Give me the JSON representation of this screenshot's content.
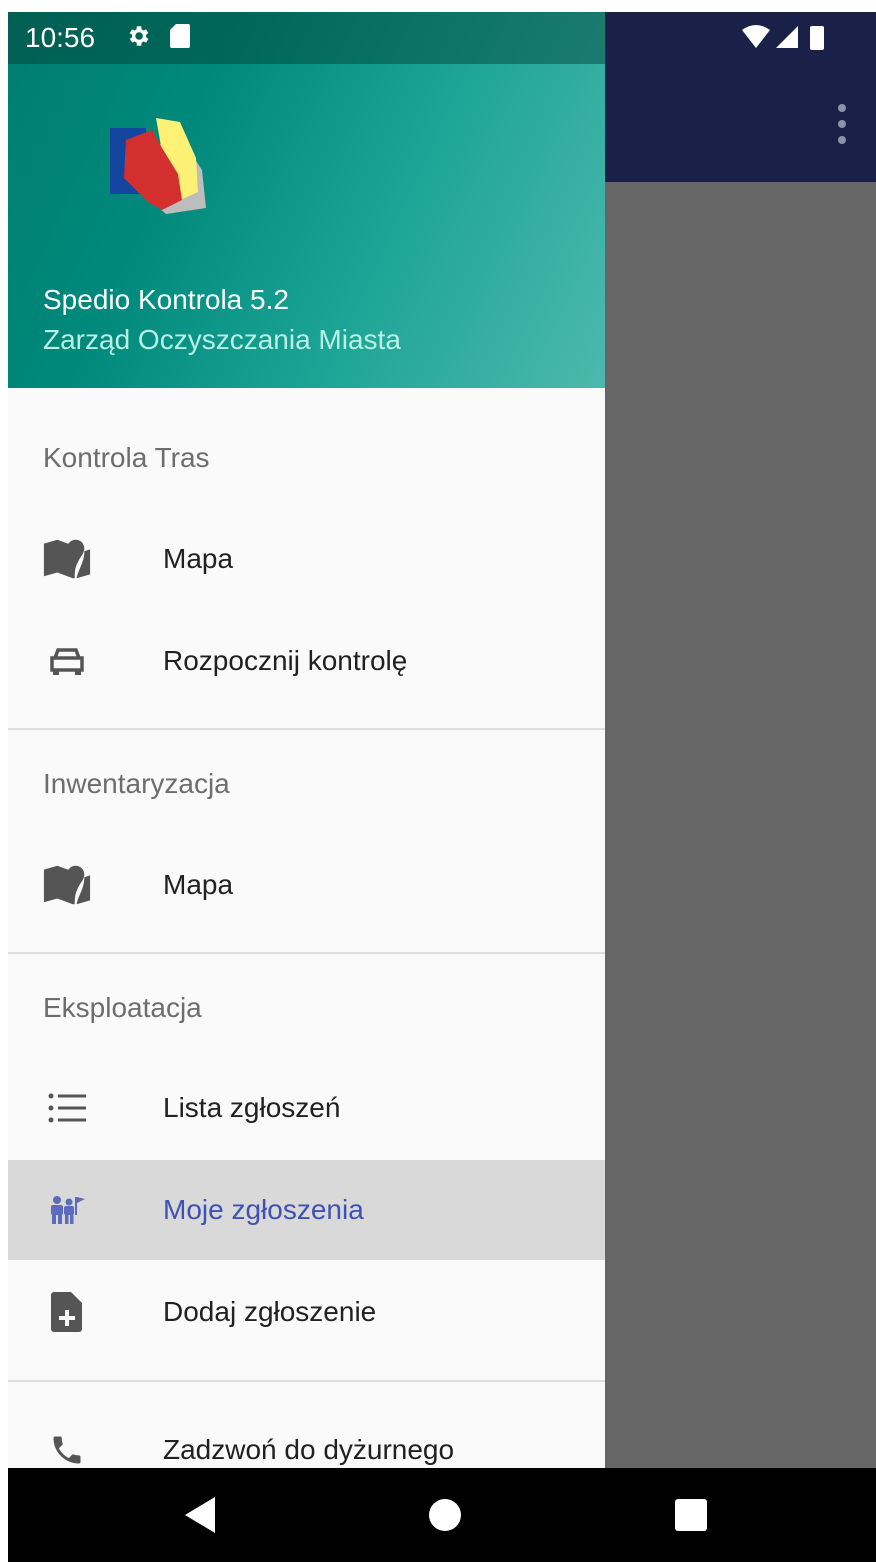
{
  "status_bar": {
    "time": "10:56"
  },
  "drawer": {
    "header": {
      "title": "Spedio Kontrola 5.2",
      "subtitle": "Zarząd Oczyszczania Miasta"
    },
    "sections": [
      {
        "header": "Kontrola Tras",
        "items": [
          {
            "label": "Mapa",
            "icon": "map-icon"
          },
          {
            "label": "Rozpocznij kontrolę",
            "icon": "car-icon"
          }
        ]
      },
      {
        "header": "Inwentaryzacja",
        "items": [
          {
            "label": "Mapa",
            "icon": "map-icon"
          }
        ]
      },
      {
        "header": "Eksploatacja",
        "items": [
          {
            "label": "Lista zgłoszeń",
            "icon": "list-icon"
          },
          {
            "label": "Moje zgłoszenia",
            "icon": "person-flag-icon",
            "selected": true
          },
          {
            "label": "Dodaj zgłoszenie",
            "icon": "add-document-icon"
          }
        ]
      },
      {
        "header": "",
        "items": [
          {
            "label": "Zadzwoń do dyżurnego",
            "icon": "phone-icon"
          }
        ]
      }
    ]
  },
  "colors": {
    "header_start": "#00897b",
    "app_bar": "#1a2148",
    "selected_text": "#3f51b5",
    "scrim": "#666666"
  }
}
